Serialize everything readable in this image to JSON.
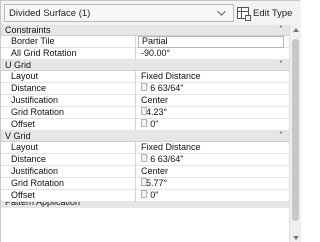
{
  "header": {
    "type_selector": "Divided Surface (1)",
    "edit_type_label": "Edit Type"
  },
  "groups": [
    {
      "label": "Constraints",
      "rows": [
        {
          "name": "Border Tile",
          "value": "Partial",
          "boxed": true
        },
        {
          "name": "All Grid Rotation",
          "value": "-90.00°",
          "boxed": false
        }
      ]
    },
    {
      "label": "U Grid",
      "rows": [
        {
          "name": "Layout",
          "value": "Fixed Distance",
          "boxed": false
        },
        {
          "name": "Distance",
          "value": "2'  6 63/64\"",
          "boxed": false,
          "button": true
        },
        {
          "name": "Justification",
          "value": "Center",
          "boxed": false
        },
        {
          "name": "Grid Rotation",
          "value": "34.23°",
          "boxed": false,
          "button": true
        },
        {
          "name": "Offset",
          "value": "0'  0\"",
          "boxed": false,
          "button": true
        }
      ]
    },
    {
      "label": "V Grid",
      "rows": [
        {
          "name": "Layout",
          "value": "Fixed Distance",
          "boxed": false
        },
        {
          "name": "Distance",
          "value": "2'  6 63/64\"",
          "boxed": false,
          "button": true
        },
        {
          "name": "Justification",
          "value": "Center",
          "boxed": false
        },
        {
          "name": "Grid Rotation",
          "value": "55.77°",
          "boxed": false,
          "button": true
        },
        {
          "name": "Offset",
          "value": "0'  0\"",
          "boxed": false,
          "button": true
        }
      ]
    }
  ],
  "partial_group_label": "Pattern Application",
  "icons": {
    "type_chevron": "chevron-down-icon",
    "edit_type": "edit-type-icon",
    "collapse": "collapse-double-chevron-icon"
  }
}
